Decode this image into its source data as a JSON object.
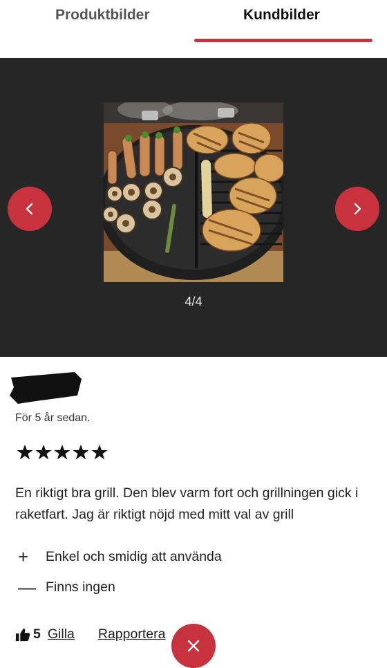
{
  "tabs": [
    {
      "label": "Produktbilder",
      "active": false
    },
    {
      "label": "Kundbilder",
      "active": true
    }
  ],
  "accent_color": "#c8323c",
  "gallery": {
    "counter": "4/4",
    "image_alt": "grill-with-mushrooms-chicken-asparagus",
    "prev_icon": "chevron-left-icon",
    "next_icon": "chevron-right-icon"
  },
  "review": {
    "date": "För 5 år sedan.",
    "rating": 5,
    "rating_max": 5,
    "text": "En riktigt bra grill. Den blev varm fort och grillningen gick i raketfart. Jag är riktigt nöjd med mitt val av grill",
    "pro_text": "Enkel och smidig att använda",
    "con_text": "Finns ingen",
    "pro_sign": "+",
    "con_sign": "—"
  },
  "actions": {
    "like_count": "5",
    "like_label": "Gilla",
    "report_label": "Rapportera",
    "thumb_icon": "thumbs-up-icon",
    "close_icon": "close-icon"
  }
}
